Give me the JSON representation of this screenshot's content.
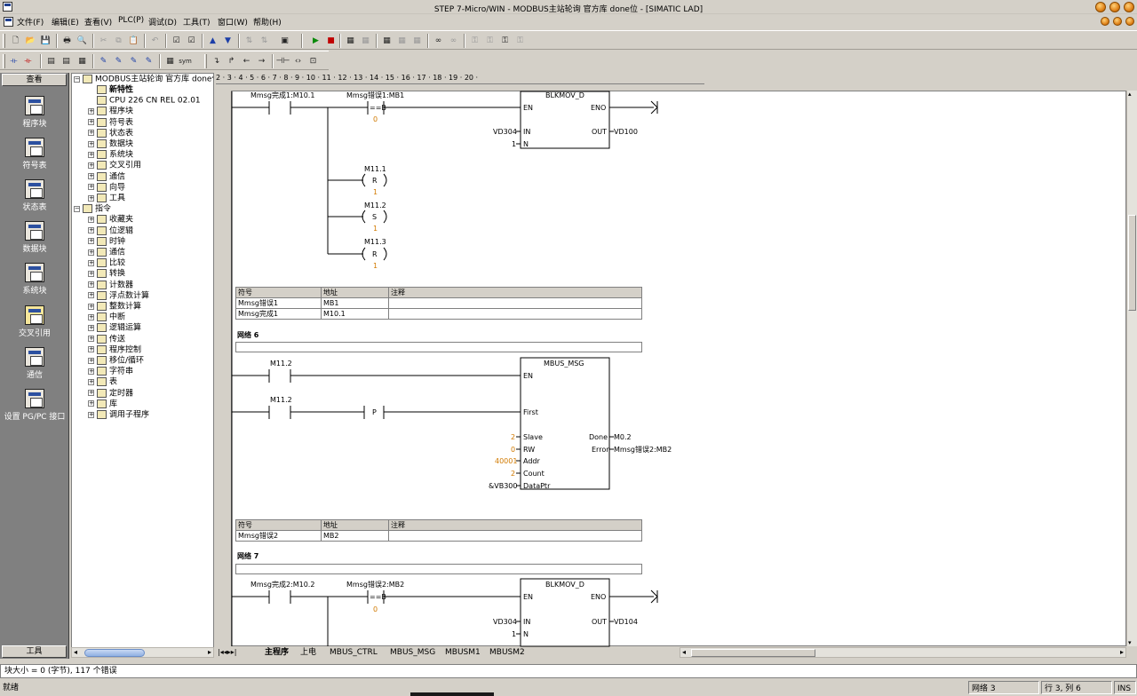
{
  "window": {
    "title": "STEP 7-Micro/WIN - MODBUS主站轮询 官方库 done位 - [SIMATIC LAD]"
  },
  "menu": [
    "文件(F)",
    "编辑(E)",
    "查看(V)",
    "PLC(P)",
    "调试(D)",
    "工具(T)",
    "窗口(W)",
    "帮助(H)"
  ],
  "navbar": {
    "header": "查看",
    "footer": "工具",
    "items": [
      "程序块",
      "符号表",
      "状态表",
      "数据块",
      "系统块",
      "交叉引用",
      "通信",
      "设置 PG/PC 接口"
    ]
  },
  "tree": {
    "root": "MODBUS主站轮询 官方库 done位",
    "nodes": [
      "新特性",
      "CPU 226 CN REL 02.01",
      "程序块",
      "符号表",
      "状态表",
      "数据块",
      "系统块",
      "交叉引用",
      "通信",
      "向导",
      "工具",
      "指令",
      "收藏夹",
      "位逻辑",
      "时钟",
      "通信",
      "比较",
      "转换",
      "计数器",
      "浮点数计算",
      "整数计算",
      "中断",
      "逻辑运算",
      "传送",
      "程序控制",
      "移位/循环",
      "字符串",
      "表",
      "定时器",
      "库",
      "调用子程序"
    ]
  },
  "ruler": "2 · 3 · 4 · 5 · 6 · 7 · 8 · 9 · 10 · 11 · 12 · 13 · 14 · 15 · 16 · 17 · 18 ·  19 · 20 ·",
  "ladder": {
    "net5": {
      "contact1": "Mmsg完成1:M10.1",
      "contact2": "Mmsg错误1:MB1",
      "cmp_op": "==B",
      "cmp_val": "0",
      "block": "BLKMOV_D",
      "en": "EN",
      "eno": "ENO",
      "in_lbl": "IN",
      "in_val": "VD304",
      "out_lbl": "OUT",
      "out_val": "VD100",
      "n_lbl": "N",
      "n_val": "1",
      "coils": [
        {
          "addr": "M11.1",
          "op": "R",
          "n": "1"
        },
        {
          "addr": "M11.2",
          "op": "S",
          "n": "1"
        },
        {
          "addr": "M11.3",
          "op": "R",
          "n": "1"
        }
      ],
      "symtable": {
        "headers": [
          "符号",
          "地址",
          "注释"
        ],
        "rows": [
          [
            "Mmsg错误1",
            "MB1",
            ""
          ],
          [
            "Mmsg完成1",
            "M10.1",
            ""
          ]
        ]
      }
    },
    "net6": {
      "label": "网络 6",
      "contact1": "M11.2",
      "contact2": "M11.2",
      "pos_edge": "P",
      "block": "MBUS_MSG",
      "en": "EN",
      "first": "First",
      "pins": [
        {
          "name": "Slave",
          "val": "2"
        },
        {
          "name": "RW",
          "val": "0"
        },
        {
          "name": "Addr",
          "val": "40001"
        },
        {
          "name": "Count",
          "val": "2"
        },
        {
          "name": "DataPtr",
          "val": "&VB300"
        }
      ],
      "outs": [
        {
          "name": "Done",
          "val": "M0.2"
        },
        {
          "name": "Error",
          "val": "Mmsg错误2:MB2"
        }
      ],
      "symtable": {
        "headers": [
          "符号",
          "地址",
          "注释"
        ],
        "rows": [
          [
            "Mmsg错误2",
            "MB2",
            ""
          ]
        ]
      }
    },
    "net7": {
      "label": "网络 7",
      "contact1": "Mmsg完成2:M10.2",
      "contact2": "Mmsg错误2:MB2",
      "cmp_op": "==B",
      "cmp_val": "0",
      "block": "BLKMOV_D",
      "en": "EN",
      "eno": "ENO",
      "in_lbl": "IN",
      "in_val": "VD304",
      "out_lbl": "OUT",
      "out_val": "VD104",
      "n_lbl": "N",
      "n_val": "1"
    }
  },
  "tabs": [
    "主程序",
    "上电",
    "MBUS_CTRL",
    "MBUS_MSG",
    "MBUSM1",
    "MBUSM2"
  ],
  "status": {
    "message": "块大小 = 0 (字节), 117 个错误",
    "ready": "就绪",
    "network": "网络 3",
    "position": "行 3, 列 6",
    "mode": "INS"
  }
}
